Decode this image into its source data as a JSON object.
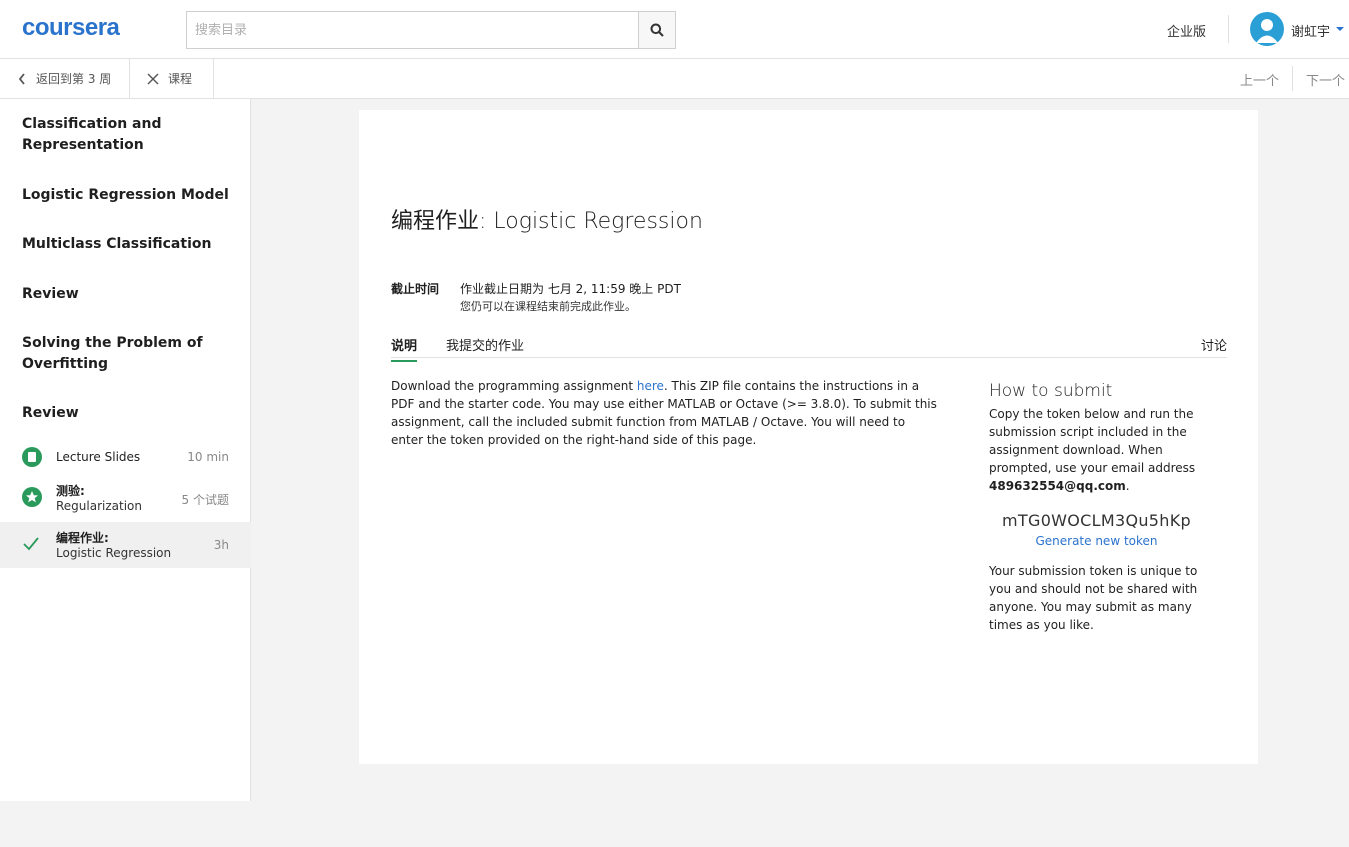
{
  "header": {
    "logo": "coursera",
    "search_placeholder": "搜索目录",
    "enterprise": "企业版",
    "username": "谢虹宇"
  },
  "subnav": {
    "back": "返回到第 3 周",
    "course": "课程",
    "prev": "上一个",
    "next": "下一个"
  },
  "sidebar": {
    "sections": [
      "Classification and Representation",
      "Logistic Regression Model",
      "Multiclass Classification",
      "Review",
      "Solving the Problem of Overfitting",
      "Review"
    ],
    "items": [
      {
        "title": "Lecture Slides",
        "subtitle": "",
        "meta": "10 min"
      },
      {
        "title": "测验:",
        "subtitle": "Regularization",
        "meta": "5 个试题"
      },
      {
        "title": "编程作业:",
        "subtitle": "Logistic Regression",
        "meta": "3h"
      }
    ]
  },
  "main": {
    "title": "编程作业: Logistic Regression",
    "deadline_label": "截止时间",
    "deadline_text": "作业截止日期为 七月 2, 11:59 晚上 PDT",
    "deadline_note": "您仍可以在课程结束前完成此作业。",
    "tabs": [
      "说明",
      "我提交的作业",
      "讨论"
    ],
    "description_before": "Download the programming assignment ",
    "description_link": "here",
    "description_after": ". This ZIP file contains the instructions in a PDF and the starter code. You may use either MATLAB or Octave (>= 3.8.0). To submit this assignment, call the included submit function from MATLAB / Octave. You will need to enter the token provided on the right-hand side of this page.",
    "howto_title": "How to submit",
    "howto_text": "Copy the token below and run the submission script included in the assignment download. When prompted, use your email address ",
    "email": "489632554@qq.com",
    "email_suffix": ".",
    "token": "mTG0WOCLM3Qu5hKp",
    "generate": "Generate new token",
    "note": "Your submission token is unique to you and should not be shared with anyone. You may submit as many times as you like."
  },
  "colors": {
    "brand": "#2a73cc",
    "accent": "#2a9a5c"
  }
}
